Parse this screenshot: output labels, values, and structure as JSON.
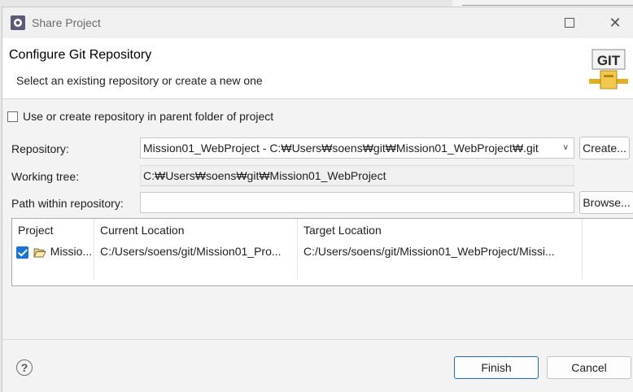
{
  "dialog": {
    "title": "Share Project",
    "icon": "eclipse-gear-icon",
    "banner_title": "Configure Git Repository",
    "banner_description": "Select an existing repository or create a new one",
    "banner_logo_text": "GIT"
  },
  "form": {
    "use_parent_checkbox_label": "Use or create repository in parent folder of project",
    "use_parent_checked": false,
    "repository_label": "Repository:",
    "repository_value": "Mission01_WebProject - C:₩Users₩soens₩git₩Mission01_WebProject₩.git",
    "create_button": "Create...",
    "working_tree_label": "Working tree:",
    "working_tree_value": "C:₩Users₩soens₩git₩Mission01_WebProject",
    "path_label": "Path within repository:",
    "path_value": "",
    "browse_button": "Browse..."
  },
  "table": {
    "headers": [
      "Project",
      "Current Location",
      "Target Location"
    ],
    "rows": [
      {
        "checked": true,
        "project": "Missio...",
        "current_location": "C:/Users/soens/git/Mission01_Pro...",
        "target_location": "C:/Users/soens/git/Mission01_WebProject/Missi..."
      }
    ]
  },
  "footer": {
    "finish_button": "Finish",
    "cancel_button": "Cancel",
    "help_symbol": "?"
  },
  "colors": {
    "accent": "#1a73d8",
    "default_button_border": "#1b6ec2"
  }
}
